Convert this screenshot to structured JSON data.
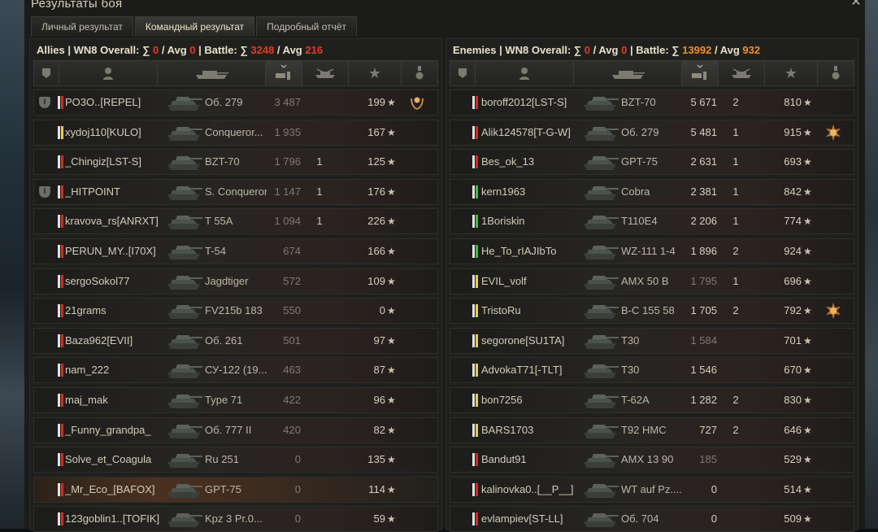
{
  "window": {
    "title": "Результаты боя",
    "close_icon": "close-icon"
  },
  "tabs": [
    {
      "label": "Личный результат",
      "active": false
    },
    {
      "label": "Командный результат",
      "active": true
    },
    {
      "label": "Подробный отчёт",
      "active": false
    }
  ],
  "allies": {
    "label": "Allies",
    "wn8_label": "WN8 Overall:",
    "overall_sum": "0",
    "overall_avg": "0",
    "battle_label": "Battle:",
    "battle_sum": "3248",
    "battle_avg": "216",
    "rows": [
      {
        "platoon": true,
        "color": "red",
        "player": "PO3O..[REPEL]",
        "tank": "Об. 279",
        "dmg": "3 487",
        "dmg_bright": false,
        "kills": "",
        "xp": "199",
        "medal": "laurel"
      },
      {
        "platoon": false,
        "color": "yellow",
        "player": "xydoj110[KULO]",
        "tank": "Conqueror...",
        "dmg": "1 935",
        "dmg_bright": false,
        "kills": "",
        "xp": "167",
        "medal": ""
      },
      {
        "platoon": false,
        "color": "red",
        "player": "_Chingiz[LST-S]",
        "tank": "BZT-70",
        "dmg": "1 796",
        "dmg_bright": false,
        "kills": "1",
        "xp": "125",
        "medal": ""
      },
      {
        "platoon": true,
        "color": "red",
        "player": "_HITPOINT",
        "tank": "S. Conqueror",
        "dmg": "1 147",
        "dmg_bright": false,
        "kills": "1",
        "xp": "176",
        "medal": ""
      },
      {
        "platoon": false,
        "color": "red",
        "player": "kravova_rs[ANRXT]",
        "tank": "T 55A",
        "dmg": "1 094",
        "dmg_bright": false,
        "kills": "1",
        "xp": "226",
        "medal": ""
      },
      {
        "platoon": false,
        "color": "red",
        "player": "PERUN_MY..[I70X]",
        "tank": "T-54",
        "dmg": "674",
        "dmg_bright": false,
        "kills": "",
        "xp": "166",
        "medal": ""
      },
      {
        "platoon": false,
        "color": "red",
        "player": "sergoSokol77",
        "tank": "Jagdtiger",
        "dmg": "572",
        "dmg_bright": false,
        "kills": "",
        "xp": "109",
        "medal": ""
      },
      {
        "platoon": false,
        "color": "red",
        "player": "21grams",
        "tank": "FV215b 183",
        "dmg": "550",
        "dmg_bright": false,
        "kills": "",
        "xp": "0",
        "medal": ""
      },
      {
        "platoon": false,
        "color": "red",
        "player": "Baza962[EVII]",
        "tank": "Об. 261",
        "dmg": "501",
        "dmg_bright": false,
        "kills": "",
        "xp": "97",
        "medal": ""
      },
      {
        "platoon": false,
        "color": "red",
        "player": "nam_222",
        "tank": "СУ-122 (19...",
        "dmg": "463",
        "dmg_bright": false,
        "kills": "",
        "xp": "87",
        "medal": ""
      },
      {
        "platoon": false,
        "color": "red",
        "player": "maj_mak",
        "tank": "Type 71",
        "dmg": "422",
        "dmg_bright": false,
        "kills": "",
        "xp": "96",
        "medal": ""
      },
      {
        "platoon": false,
        "color": "red",
        "player": "_Funny_grandpa_",
        "tank": "Об. 777 II",
        "dmg": "420",
        "dmg_bright": false,
        "kills": "",
        "xp": "82",
        "medal": ""
      },
      {
        "platoon": false,
        "color": "red",
        "player": "Solve_et_Coagula",
        "tank": "Ru 251",
        "dmg": "0",
        "dmg_bright": false,
        "kills": "",
        "xp": "135",
        "medal": ""
      },
      {
        "platoon": false,
        "color": "red",
        "player": "_Mr_Eco_[BAFOX]",
        "tank": "GPT-75",
        "dmg": "0",
        "dmg_bright": false,
        "kills": "",
        "xp": "114",
        "medal": "",
        "highlight": true
      },
      {
        "platoon": false,
        "color": "red",
        "player": "123goblin1..[TOFIK]",
        "tank": "Kpz 3 Pr.0...",
        "dmg": "0",
        "dmg_bright": false,
        "kills": "",
        "xp": "59",
        "medal": ""
      }
    ]
  },
  "enemies": {
    "label": "Enemies",
    "wn8_label": "WN8 Overall:",
    "overall_sum": "0",
    "overall_avg": "0",
    "battle_label": "Battle:",
    "battle_sum": "13992",
    "battle_avg": "932",
    "rows": [
      {
        "color": "red",
        "player": "boroff2012[LST-S]",
        "tank": "BZT-70",
        "dmg": "5 671",
        "dmg_bright": true,
        "kills": "2",
        "xp": "810",
        "medal": ""
      },
      {
        "color": "red",
        "player": "Alik124578[T-G-W]",
        "tank": "Об. 279",
        "dmg": "5 481",
        "dmg_bright": true,
        "kills": "1",
        "xp": "915",
        "medal": "order"
      },
      {
        "color": "red",
        "player": "Bes_ok_13",
        "tank": "GPT-75",
        "dmg": "2 631",
        "dmg_bright": true,
        "kills": "1",
        "xp": "693",
        "medal": ""
      },
      {
        "color": "green",
        "player": "kern1963",
        "tank": "Cobra",
        "dmg": "2 381",
        "dmg_bright": true,
        "kills": "1",
        "xp": "842",
        "medal": ""
      },
      {
        "color": "green",
        "player": "1Boriskin",
        "tank": "T110E4",
        "dmg": "2 206",
        "dmg_bright": true,
        "kills": "1",
        "xp": "774",
        "medal": ""
      },
      {
        "color": "green",
        "player": "He_To_rIAJIbTo",
        "tank": "WZ-111 1-4",
        "dmg": "1 896",
        "dmg_bright": true,
        "kills": "2",
        "xp": "924",
        "medal": ""
      },
      {
        "color": "yellow",
        "player": "EVIL_volf",
        "tank": "AMX 50 B",
        "dmg": "1 795",
        "dmg_bright": false,
        "kills": "1",
        "xp": "696",
        "medal": ""
      },
      {
        "color": "yellow",
        "player": "TristoRu",
        "tank": "B-C 155 58",
        "dmg": "1 705",
        "dmg_bright": true,
        "kills": "2",
        "xp": "792",
        "medal": "order"
      },
      {
        "color": "yellow",
        "player": "segorone[SU1TA]",
        "tank": "T30",
        "dmg": "1 584",
        "dmg_bright": false,
        "kills": "",
        "xp": "701",
        "medal": ""
      },
      {
        "color": "yellow",
        "player": "AdvokaT71[-TLT]",
        "tank": "T30",
        "dmg": "1 546",
        "dmg_bright": true,
        "kills": "",
        "xp": "670",
        "medal": ""
      },
      {
        "color": "yellow",
        "player": "bon7256",
        "tank": "T-62A",
        "dmg": "1 282",
        "dmg_bright": true,
        "kills": "2",
        "xp": "830",
        "medal": ""
      },
      {
        "color": "yellow",
        "player": "BARS1703",
        "tank": "T92 HMC",
        "dmg": "727",
        "dmg_bright": true,
        "kills": "2",
        "xp": "646",
        "medal": ""
      },
      {
        "color": "red",
        "player": "Bandut91",
        "tank": "AMX 13 90",
        "dmg": "185",
        "dmg_bright": false,
        "kills": "",
        "xp": "529",
        "medal": ""
      },
      {
        "color": "red",
        "player": "kalinovka0..[__P__]",
        "tank": "WT auf Pz....",
        "dmg": "0",
        "dmg_bright": true,
        "kills": "",
        "xp": "514",
        "medal": ""
      },
      {
        "color": "red",
        "player": "evlampiev[ST-LL]",
        "tank": "Об. 704",
        "dmg": "0",
        "dmg_bright": true,
        "kills": "",
        "xp": "509",
        "medal": ""
      }
    ]
  },
  "columns": [
    "platoon",
    "player",
    "tank",
    "damage",
    "kills",
    "xp",
    "medals"
  ],
  "colors": {
    "red": "#d82a1f",
    "yellow": "#e8d23a",
    "green": "#3cc13c",
    "accent_red": "#e8391f",
    "accent_orange": "#f18d28"
  }
}
